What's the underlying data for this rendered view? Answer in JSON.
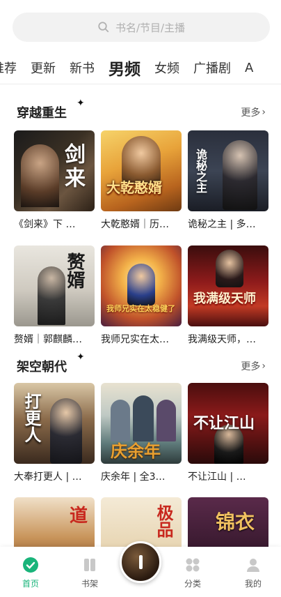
{
  "search": {
    "placeholder": "书名/节目/主播"
  },
  "tabs": [
    {
      "label": "推荐",
      "active": false
    },
    {
      "label": "更新",
      "active": false
    },
    {
      "label": "新书",
      "active": false
    },
    {
      "label": "男频",
      "active": true
    },
    {
      "label": "女频",
      "active": false
    },
    {
      "label": "广播剧",
      "active": false
    },
    {
      "label": "A",
      "active": false
    }
  ],
  "sections": [
    {
      "title": "穿越重生",
      "more": "更多",
      "books": [
        {
          "title": "《剑来》下 …",
          "cover_text": "剑来"
        },
        {
          "title": "大乾憨婿｜历…",
          "cover_text": "大乾憨婿"
        },
        {
          "title": "诡秘之主 | 多…",
          "cover_text": "诡秘之主"
        },
        {
          "title": "赘婿｜郭麒麟…",
          "cover_text": "赘婿"
        },
        {
          "title": "我师兄实在太…",
          "cover_text": "我师兄实在太稳健了"
        },
        {
          "title": "我满级天师，…",
          "cover_text": "我满级天师"
        }
      ]
    },
    {
      "title": "架空朝代",
      "more": "更多",
      "books": [
        {
          "title": "大奉打更人 | …",
          "cover_text": "打更人"
        },
        {
          "title": "庆余年 | 全3…",
          "cover_text": "庆余年"
        },
        {
          "title": "不让江山 | …",
          "cover_text": "不让江山"
        },
        {
          "title": "",
          "cover_text": "道"
        },
        {
          "title": "",
          "cover_text": "极品"
        },
        {
          "title": "",
          "cover_text": "锦衣"
        }
      ]
    }
  ],
  "bottom_nav": [
    {
      "label": "首页",
      "active": true,
      "icon": "home-icon"
    },
    {
      "label": "书架",
      "active": false,
      "icon": "bookshelf-icon"
    },
    {
      "label": "分类",
      "active": false,
      "icon": "category-icon"
    },
    {
      "label": "我的",
      "active": false,
      "icon": "profile-icon"
    }
  ],
  "colors": {
    "accent": "#19b47a",
    "highlight": "#b9e9d4"
  }
}
